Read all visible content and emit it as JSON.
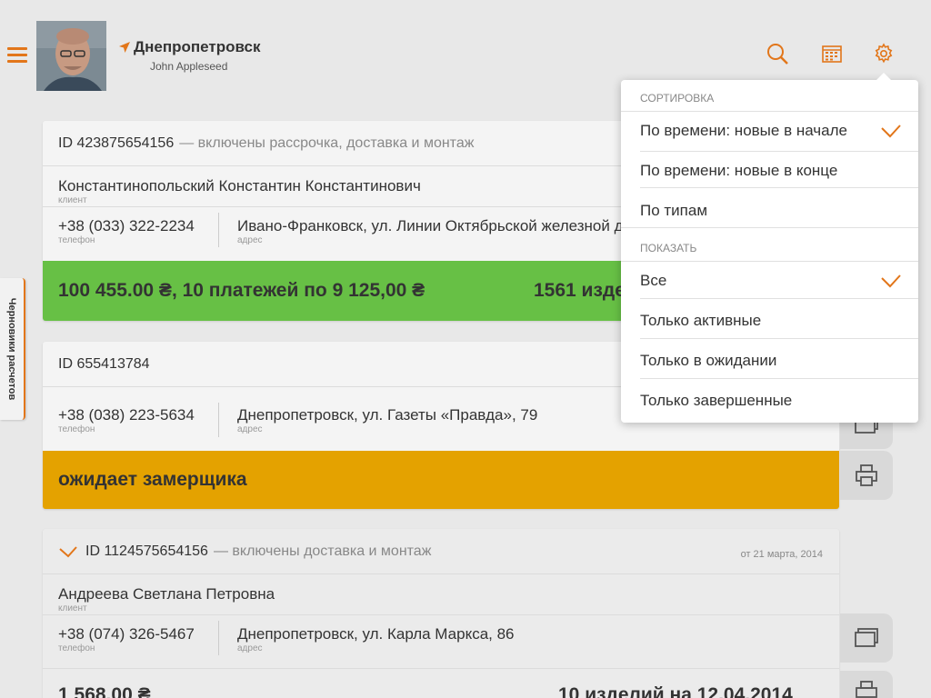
{
  "header": {
    "city": "Днепропетровск",
    "user_name": "John Appleseed"
  },
  "side_tab": {
    "label": "Черновики расчетов"
  },
  "orders": [
    {
      "id": "ID 423875654156",
      "description": "— включены рассрочка, доставка и монтаж",
      "client": "Константинопольский Константин Константинович",
      "client_label": "клиент",
      "phone": "+38 (033) 322-2234",
      "phone_label": "телефон",
      "address": "Ивано-Франковск, ул. Линии Октябрьской железной дороги, 12",
      "address_label": "адрес",
      "status_main": "100 455.00 ₴, 10 платежей по 9 125,00 ₴",
      "status_right": "1561 изделие",
      "status_color": "#67c045"
    },
    {
      "id": "ID 655413784",
      "phone": "+38 (038) 223-5634",
      "phone_label": "телефон",
      "address": "Днепропетровск, ул. Газеты «Правда», 79",
      "address_label": "адрес",
      "status_main": "ожидает замерщика",
      "status_color": "#e4a200"
    },
    {
      "id": "ID 1124575654156",
      "description": "— включены доставка и монтаж",
      "date": "от 21 марта, 2014",
      "client": "Андреева Светлана Петровна",
      "client_label": "клиент",
      "phone": "+38 (074) 326-5467",
      "phone_label": "телефон",
      "address": "Днепропетровск, ул. Карла Маркса, 86",
      "address_label": "адрес",
      "status_main": "1 568.00 ₴",
      "status_right": "10 изделий на 12.04.2014"
    }
  ],
  "dropdown": {
    "sort_title": "Сортировка",
    "sort_options": [
      "По времени: новые в начале",
      "По времени: новые в конце",
      "По типам"
    ],
    "sort_selected": 0,
    "show_title": "Показать",
    "show_options": [
      "Все",
      "Только активные",
      "Только в ожидании",
      "Только завершенные"
    ],
    "show_selected": 0
  },
  "colors": {
    "accent": "#e2761a",
    "green": "#67c045",
    "yellow": "#e4a200"
  },
  "icons": [
    "menu-icon",
    "location-arrow-icon",
    "search-icon",
    "calendar-icon",
    "gear-icon",
    "checkmark-icon",
    "copy-icon",
    "print-icon"
  ]
}
